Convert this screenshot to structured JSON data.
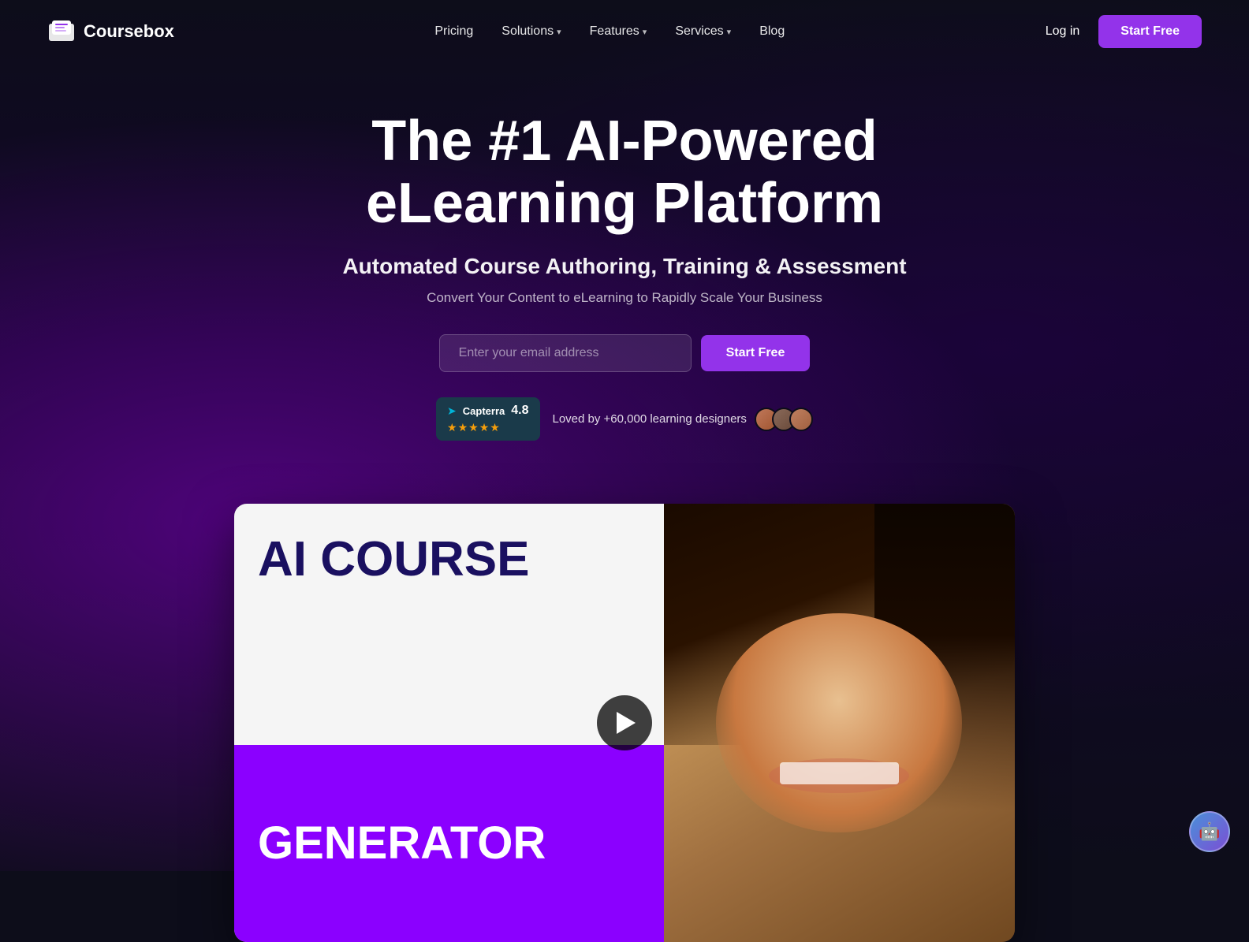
{
  "meta": {
    "title": "Coursebox - The #1 AI-Powered eLearning Platform"
  },
  "nav": {
    "logo_text": "Coursebox",
    "links": [
      {
        "label": "Pricing",
        "has_dropdown": false
      },
      {
        "label": "Solutions",
        "has_dropdown": true
      },
      {
        "label": "Features",
        "has_dropdown": true
      },
      {
        "label": "Services",
        "has_dropdown": true
      },
      {
        "label": "Blog",
        "has_dropdown": false
      }
    ],
    "login_label": "Log in",
    "start_free_label": "Start Free"
  },
  "hero": {
    "headline_line1": "The #1 AI-Powered",
    "headline_line2": "eLearning Platform",
    "subheadline": "Automated Course Authoring, Training & Assessment",
    "body": "Convert Your Content to eLearning to Rapidly Scale Your Business",
    "email_placeholder": "Enter your email address",
    "cta_label": "Start Free"
  },
  "social_proof": {
    "platform": "Capterra",
    "score": "4.8",
    "stars": "★★★★★",
    "loved_text": "Loved by +60,000 learning designers",
    "avatars": [
      "A1",
      "A2",
      "A3"
    ]
  },
  "video": {
    "title_top": "AI COURSE",
    "title_bottom": "GENERATOR",
    "play_button_label": "Play video"
  }
}
